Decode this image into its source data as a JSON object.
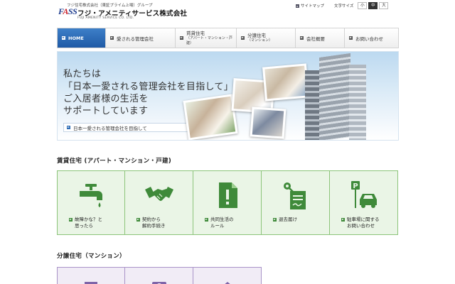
{
  "header": {
    "group_text": "フジ住宅株式会社（東証プライム上場）グループ",
    "logo_text": "FASS",
    "company_name": "フジ・アメニティサービス株式会社",
    "company_en": "FUJI AMENITY SERVICE CO. LTD.",
    "sitemap_label": "サイトマップ",
    "font_size_label": "文字サイズ",
    "font_sizes": [
      "小",
      "中",
      "大"
    ],
    "font_size_selected": "中"
  },
  "nav": {
    "items": [
      {
        "label": "HOME",
        "sub": "",
        "active": true
      },
      {
        "label": "愛される管理会社",
        "sub": ""
      },
      {
        "label": "賃貸住宅",
        "sub": "（アパート・マンション・戸建）"
      },
      {
        "label": "分譲住宅",
        "sub": "（マンション）"
      },
      {
        "label": "会社概要",
        "sub": ""
      },
      {
        "label": "お問い合わせ",
        "sub": ""
      }
    ]
  },
  "hero": {
    "line1": "私たちは",
    "line2": "「日本一愛される管理会社を目指して」",
    "line3": "ご入居者様の生活を",
    "line4": "サポートしています",
    "link_label": "日本一愛される管理会社を目指して"
  },
  "section_rental": {
    "title": "賃貸住宅 (アパート・マンション・戸建)",
    "tiles": [
      {
        "line1": "故障かな？と",
        "line2": "思ったら",
        "icon": "faucet-icon"
      },
      {
        "line1": "契約から",
        "line2": "解約手続き",
        "icon": "handshake-icon"
      },
      {
        "line1": "共同生活の",
        "line2": "ルール",
        "icon": "notice-icon"
      },
      {
        "line1": "退去届け",
        "line2": "",
        "icon": "key-document-icon"
      },
      {
        "line1": "駐車場に関する",
        "line2": "お問い合わせ",
        "icon": "parking-car-icon"
      }
    ]
  },
  "section_condo": {
    "title": "分譲住宅（マンション）"
  },
  "colors": {
    "nav_active": "#1f5aa6",
    "tile_green_bg": "#eaf5e6",
    "tile_green_border": "#8cc47a",
    "icon_green": "#3f8a3a",
    "tile_purple_bg": "#f1ecf6",
    "tile_purple_border": "#a993c8"
  }
}
